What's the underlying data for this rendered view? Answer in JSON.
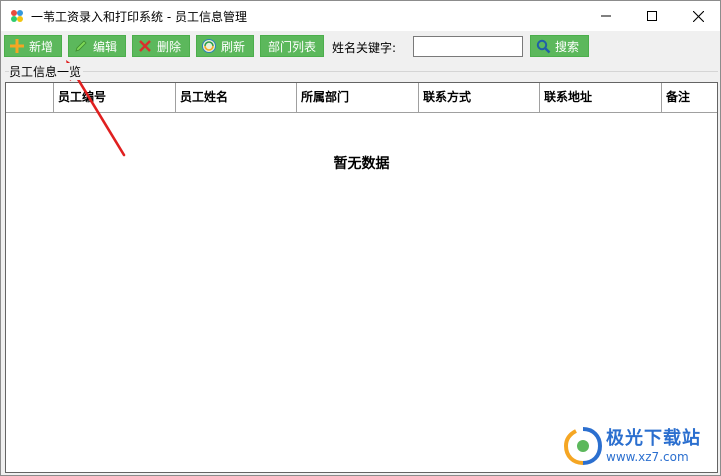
{
  "window": {
    "title": "一苇工资录入和打印系统 - 员工信息管理",
    "icons": {
      "app": "colorful-flower-icon",
      "minimize": "minimize-icon",
      "maximize": "maximize-icon",
      "close": "close-icon"
    }
  },
  "toolbar": {
    "add_label": "新增",
    "edit_label": "编辑",
    "delete_label": "删除",
    "refresh_label": "刷新",
    "dept_label": "部门列表",
    "search_label": "姓名关键字:",
    "search_value": "",
    "search_button_label": "搜索",
    "icons": {
      "add": "plus-icon",
      "edit": "pencil-icon",
      "delete": "x-icon",
      "refresh": "refresh-icon",
      "search": "magnifier-icon"
    },
    "button_color": "#5cb85c"
  },
  "group": {
    "label": "员工信息一览"
  },
  "grid": {
    "columns": [
      "",
      "员工编号",
      "员工姓名",
      "所属部门",
      "联系方式",
      "联系地址",
      "备注"
    ],
    "rows": [],
    "empty_text": "暂无数据"
  },
  "watermark": {
    "title": "极光下载站",
    "url": "www.xz7.com"
  },
  "annotation": {
    "color": "#e02020"
  }
}
